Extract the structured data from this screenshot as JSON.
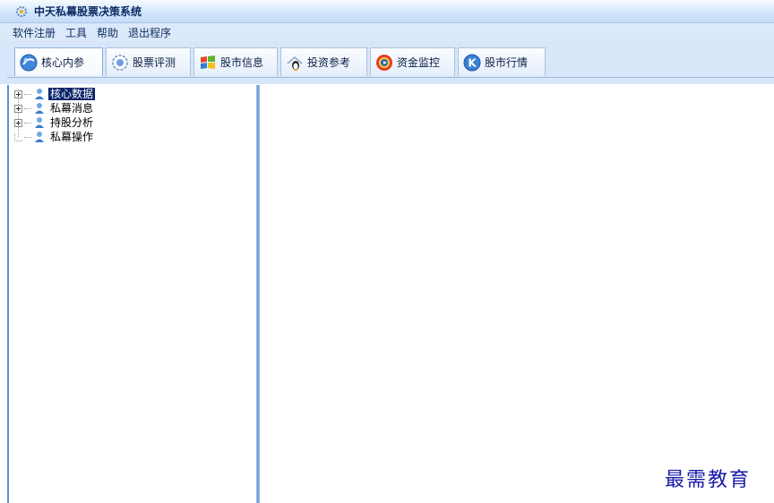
{
  "window": {
    "title": "中天私幕股票决策系统",
    "icon": "app-gear-icon"
  },
  "menu": {
    "items": [
      "软件注册",
      "工具",
      "帮助",
      "退出程序"
    ]
  },
  "toolbar": {
    "tabs": [
      {
        "label": "核心内参",
        "icon": "globe-icon",
        "active": true
      },
      {
        "label": "股票评测",
        "icon": "stock-review-icon",
        "active": false
      },
      {
        "label": "股市信息",
        "icon": "windows-flag-icon",
        "active": false
      },
      {
        "label": "投资参考",
        "icon": "penguin-icon",
        "active": false
      },
      {
        "label": "资金监控",
        "icon": "monitor-disc-icon",
        "active": false
      },
      {
        "label": "股市行情",
        "icon": "k-letter-icon",
        "active": false
      }
    ]
  },
  "tree": {
    "nodes": [
      {
        "label": "核心数据",
        "expandable": true,
        "selected": true
      },
      {
        "label": "私幕消息",
        "expandable": true,
        "selected": false
      },
      {
        "label": "持股分析",
        "expandable": true,
        "selected": false
      },
      {
        "label": "私幕操作",
        "expandable": false,
        "selected": false
      }
    ]
  },
  "watermark": {
    "text": "最需教育"
  },
  "colors": {
    "titlebar": "#d3e7fb",
    "menubar": "#dbe9fa",
    "selection": "#0a246a",
    "watermark": "#1a1aa8"
  }
}
